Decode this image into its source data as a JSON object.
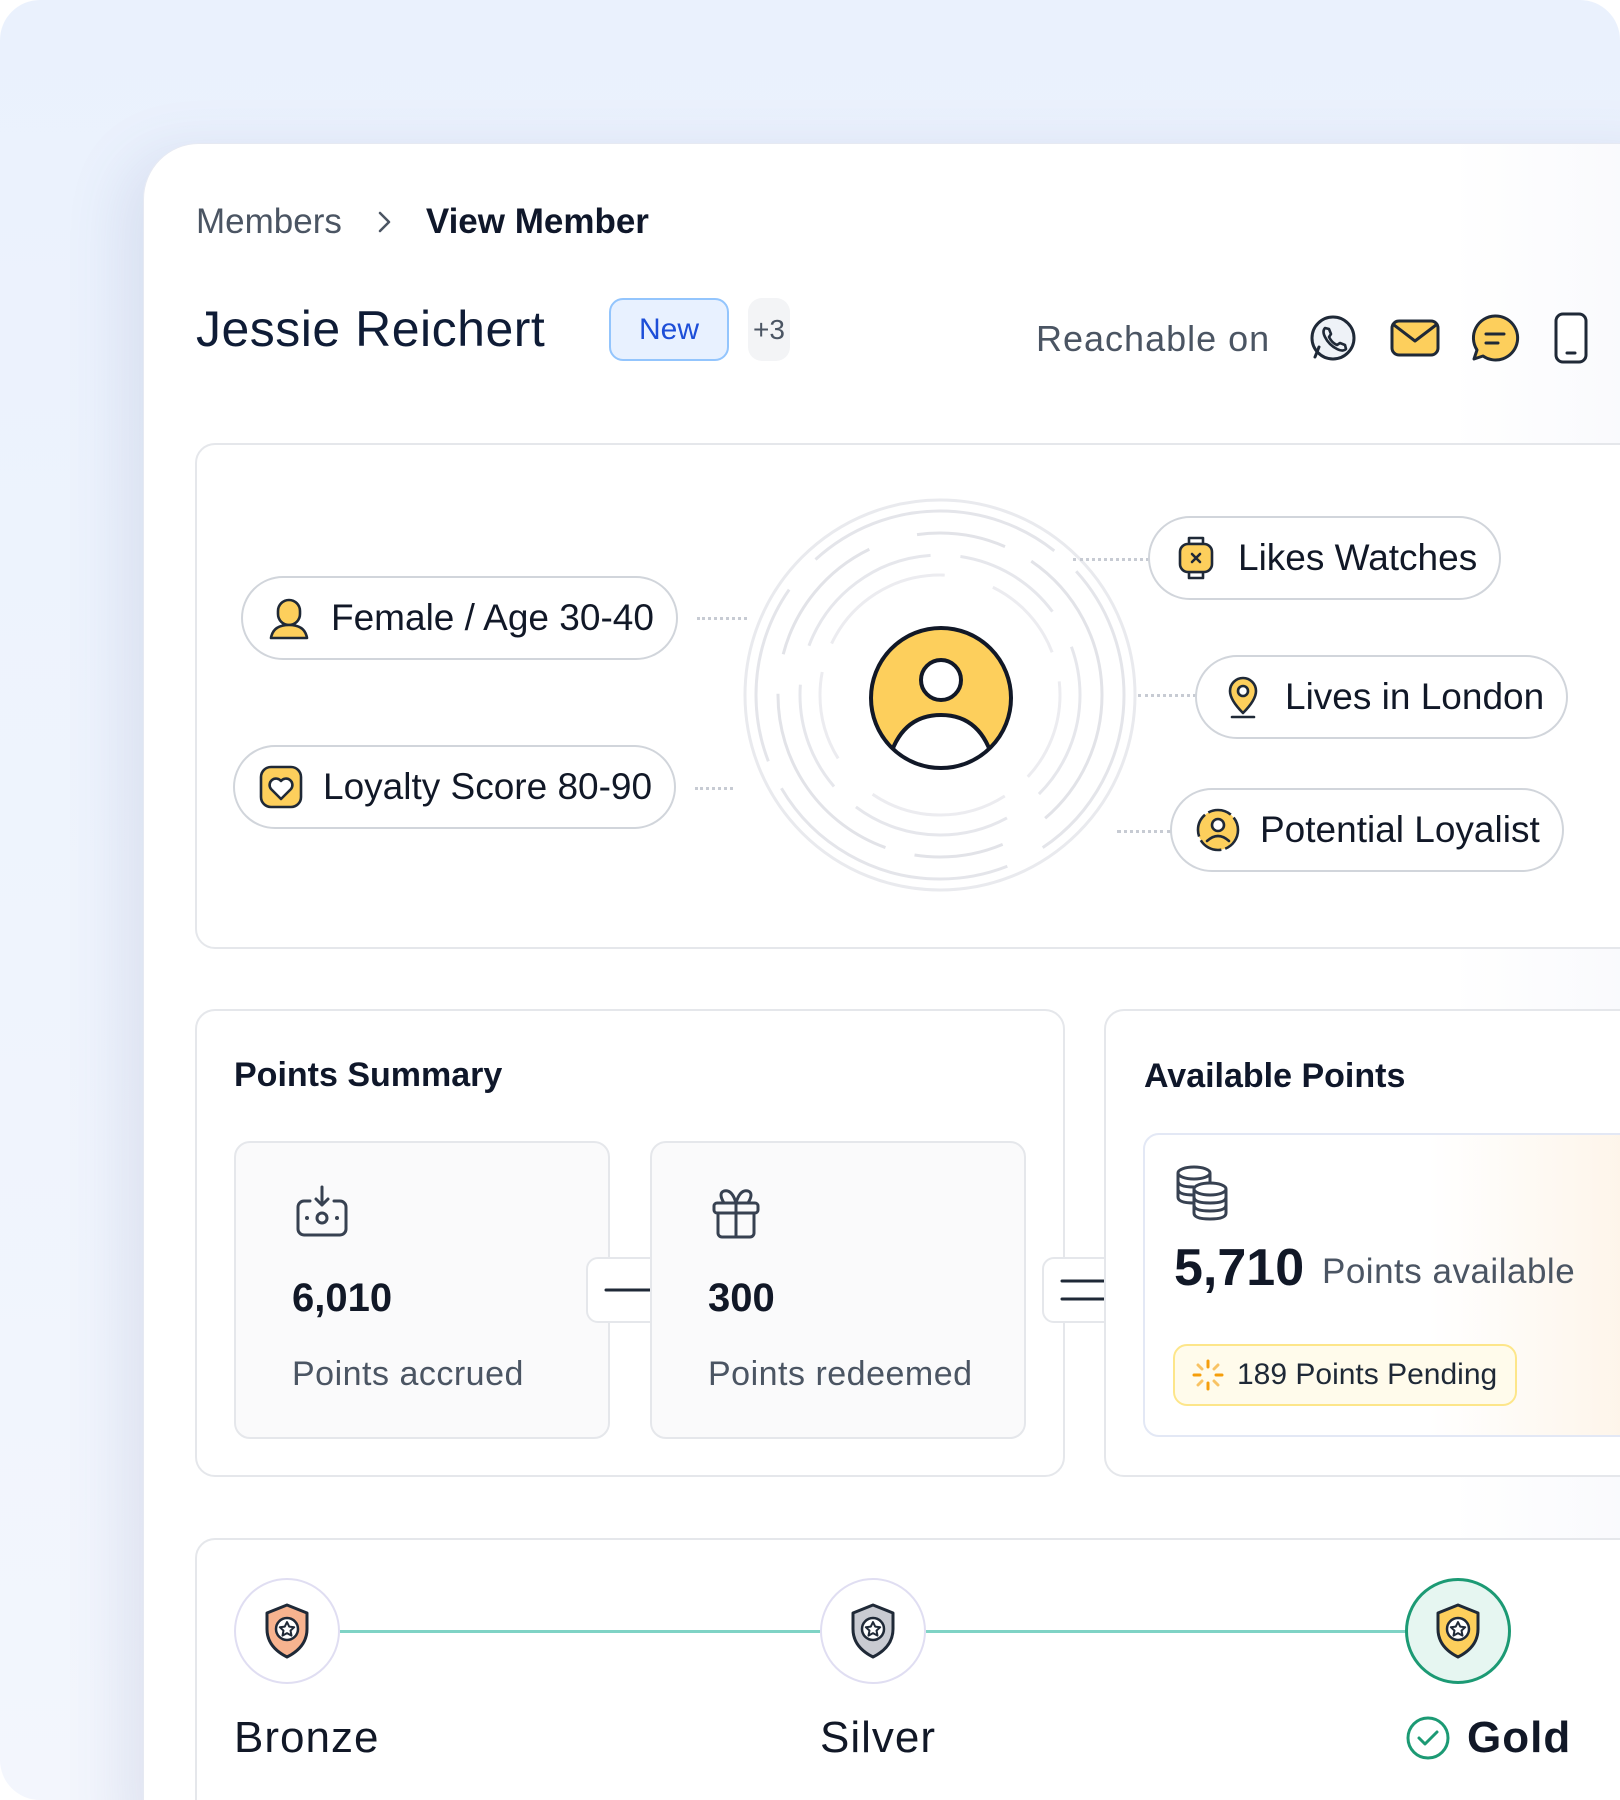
{
  "breadcrumb": {
    "parent": "Members",
    "current": "View Member"
  },
  "member": {
    "name": "Jessie Reichert",
    "badge": "New",
    "extra_tags": "+3"
  },
  "contact": {
    "label": "Reachable on",
    "channels": [
      "whatsapp-icon",
      "email-icon",
      "chat-icon",
      "mobile-icon"
    ]
  },
  "profile": {
    "left_traits": [
      "Female / Age 30-40",
      "Loyalty Score 80-90"
    ],
    "right_traits": [
      "Likes Watches",
      "Lives in London",
      "Potential Loyalist"
    ]
  },
  "points_summary": {
    "title": "Points Summary",
    "accrued_value": "6,010",
    "accrued_label": "Points accrued",
    "redeemed_value": "300",
    "redeemed_label": "Points redeemed"
  },
  "available_points": {
    "title": "Available Points",
    "value": "5,710",
    "label": "Points available",
    "pending": "189 Points Pending"
  },
  "tiers": {
    "items": [
      "Bronze",
      "Silver",
      "Gold"
    ],
    "current": "Gold"
  },
  "colors": {
    "avatar": "#fdcf5c",
    "tier_line": "#7fd3c5",
    "active_tier": "#1c9a74",
    "badge_blue": "#1d4ed8"
  }
}
